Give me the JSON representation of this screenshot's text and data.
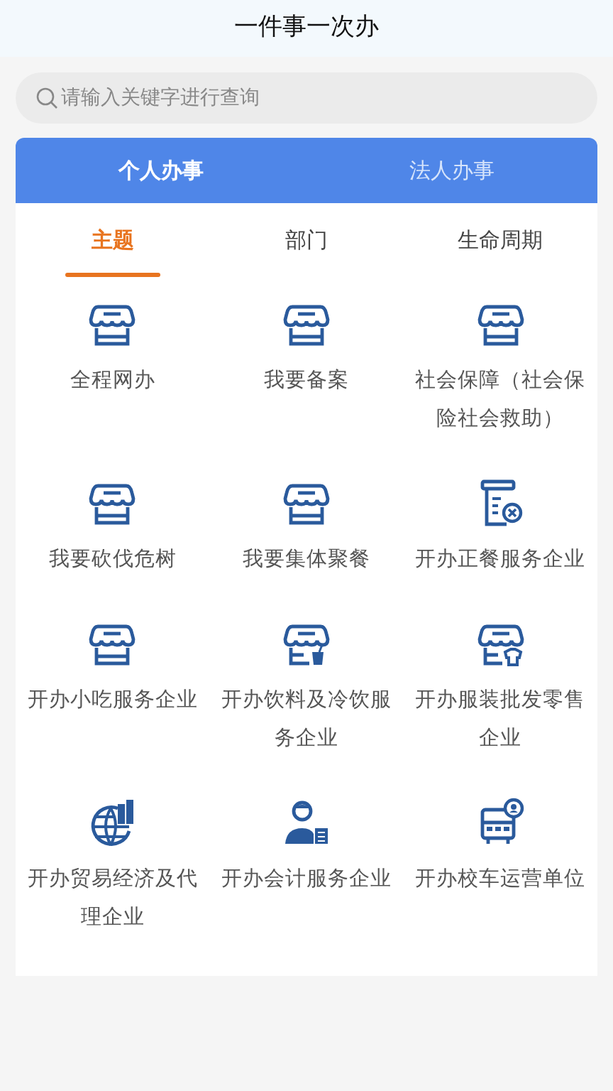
{
  "header": {
    "title": "一件事一次办"
  },
  "search": {
    "placeholder": "请输入关键字进行查询"
  },
  "tabs": [
    {
      "label": "个人办事",
      "selected": true
    },
    {
      "label": "法人办事",
      "selected": false
    }
  ],
  "subtabs": [
    {
      "label": "主题",
      "selected": true
    },
    {
      "label": "部门",
      "selected": false
    },
    {
      "label": "生命周期",
      "selected": false
    }
  ],
  "items": [
    {
      "label": "全程网办",
      "kind": "store"
    },
    {
      "label": "我要备案",
      "kind": "store"
    },
    {
      "label": "社会保障（社会保险社会救助）",
      "kind": "store"
    },
    {
      "label": "我要砍伐危树",
      "kind": "store"
    },
    {
      "label": "我要集体聚餐",
      "kind": "store"
    },
    {
      "label": "开办正餐服务企业",
      "kind": "document"
    },
    {
      "label": "开办小吃服务企业",
      "kind": "store"
    },
    {
      "label": "开办饮料及冷饮服务企业",
      "kind": "store-cup"
    },
    {
      "label": "开办服装批发零售企业",
      "kind": "store-shirt"
    },
    {
      "label": "开办贸易经济及代理企业",
      "kind": "globe"
    },
    {
      "label": "开办会计服务企业",
      "kind": "accountant"
    },
    {
      "label": "开办校车运营单位",
      "kind": "bus"
    }
  ]
}
